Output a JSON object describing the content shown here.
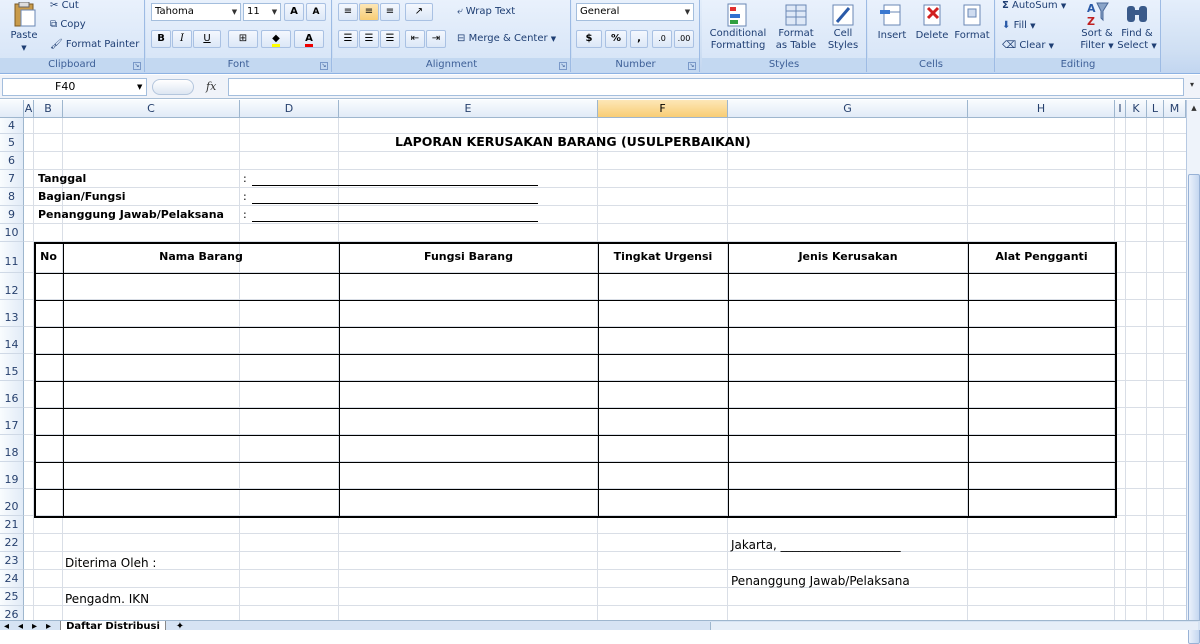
{
  "ribbon": {
    "clipboard": {
      "label": "Clipboard",
      "paste": "Paste",
      "cut": "Cut",
      "copy": "Copy",
      "format_painter": "Format Painter"
    },
    "font": {
      "label": "Font",
      "font_name": "Tahoma",
      "font_size": "11",
      "bold": "B",
      "italic": "I",
      "underline": "U",
      "grow": "A",
      "shrink": "A"
    },
    "alignment": {
      "label": "Alignment",
      "wrap_text": "Wrap Text",
      "merge_center": "Merge & Center"
    },
    "number": {
      "label": "Number",
      "format": "General",
      "currency": "$",
      "percent": "%",
      "comma": ","
    },
    "styles": {
      "label": "Styles",
      "conditional": "Conditional",
      "formatting": "Formatting",
      "format": "Format",
      "as_table": "as Table",
      "cell": "Cell",
      "cell_styles": "Styles"
    },
    "cells": {
      "label": "Cells",
      "insert": "Insert",
      "delete": "Delete",
      "format": "Format"
    },
    "editing": {
      "label": "Editing",
      "autosum": "AutoSum",
      "fill": "Fill",
      "clear": "Clear",
      "sort1": "Sort &",
      "sort2": "Filter",
      "find1": "Find &",
      "find2": "Select"
    }
  },
  "formula_bar": {
    "name_box": "F40",
    "fx": "fx",
    "content": ""
  },
  "columns": [
    "A",
    "B",
    "C",
    "D",
    "E",
    "F",
    "G",
    "H",
    "I",
    "K",
    "L",
    "M"
  ],
  "rows": [
    "4",
    "5",
    "6",
    "7",
    "8",
    "9",
    "10",
    "11",
    "12",
    "13",
    "14",
    "15",
    "16",
    "17",
    "18",
    "19",
    "20",
    "21",
    "22",
    "23",
    "24",
    "25",
    "26"
  ],
  "sheet": {
    "title": "LAPORAN KERUSAKAN BARANG (USULPERBAIKAN)",
    "fields": [
      {
        "label": "Tanggal",
        "sep": ":"
      },
      {
        "label": "Bagian/Fungsi",
        "sep": ":"
      },
      {
        "label": "Penanggung Jawab/Pelaksana",
        "sep": ":"
      }
    ],
    "table_headers": [
      "No",
      "Nama Barang",
      "Fungsi Barang",
      "Tingkat Urgensi",
      "Jenis Kerusakan",
      "Alat Pengganti"
    ],
    "diterima": "Diterima Oleh :",
    "pengadm": "Pengadm. IKN",
    "jakarta": "Jakarta, ____________________",
    "pj": "Penanggung Jawab/Pelaksana"
  },
  "tabs": {
    "active": "Daftar Distribusi"
  }
}
